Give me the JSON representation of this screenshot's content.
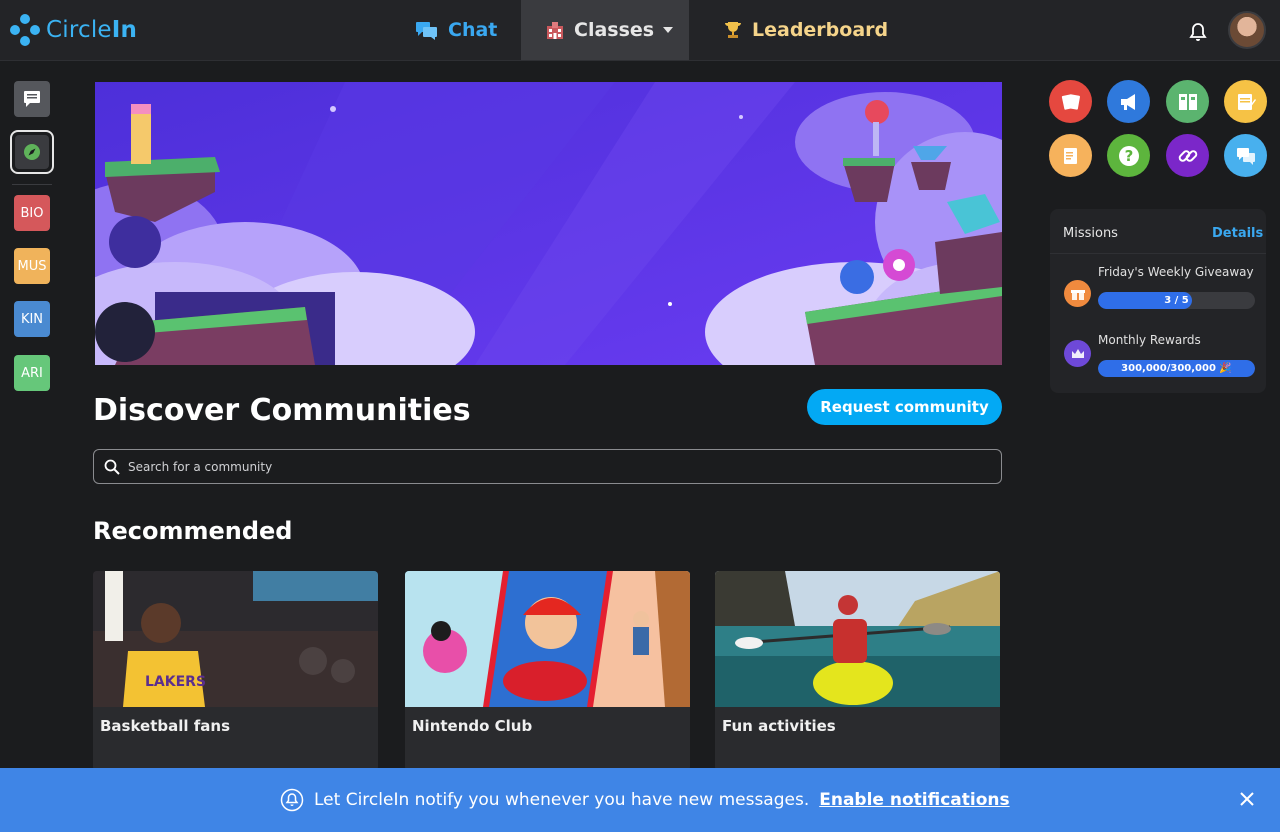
{
  "app": {
    "logo_prefix": "Circle",
    "logo_suffix": "In",
    "brand_color": "#3bb3f3"
  },
  "nav": {
    "chat": "Chat",
    "classes": "Classes",
    "leaderboard": "Leaderboard"
  },
  "sidebar": {
    "items": [
      {
        "label": "BIO",
        "color": "#d5585b"
      },
      {
        "label": "MUS",
        "color": "#f0b35b"
      },
      {
        "label": "KIN",
        "color": "#4a8ad1"
      },
      {
        "label": "ARI",
        "color": "#66c77a"
      }
    ]
  },
  "main": {
    "heading": "Discover Communities",
    "request_button": "Request community",
    "search_placeholder": "Search for a community",
    "recommended_heading": "Recommended",
    "cards": [
      {
        "title": "Basketball fans"
      },
      {
        "title": "Nintendo Club"
      },
      {
        "title": "Fun activities"
      }
    ]
  },
  "tools": [
    {
      "name": "flashcards-tool",
      "color": "#e5483f"
    },
    {
      "name": "announcement-tool",
      "color": "#2f79dc"
    },
    {
      "name": "workflow-tool",
      "color": "#5bb46f"
    },
    {
      "name": "notes-tool",
      "color": "#f6c245"
    },
    {
      "name": "study-guide-tool",
      "color": "#f6b25c"
    },
    {
      "name": "question-tool",
      "color": "#5db53d"
    },
    {
      "name": "links-tool",
      "color": "#7b27c9"
    },
    {
      "name": "discussion-tool",
      "color": "#48b0ee"
    }
  ],
  "missions": {
    "title": "Missions",
    "details": "Details",
    "items": [
      {
        "label": "Friday's Weekly Giveaway",
        "progress_text": "3 / 5",
        "progress": 0.6,
        "icon_color": "#f08a3e"
      },
      {
        "label": "Monthly Rewards",
        "progress_text": "300,000/300,000 🎉",
        "progress": 1.0,
        "icon_color": "#6e49d8"
      }
    ]
  },
  "notification": {
    "text": "Let CircleIn notify you whenever you have new messages.",
    "link": "Enable notifications"
  }
}
